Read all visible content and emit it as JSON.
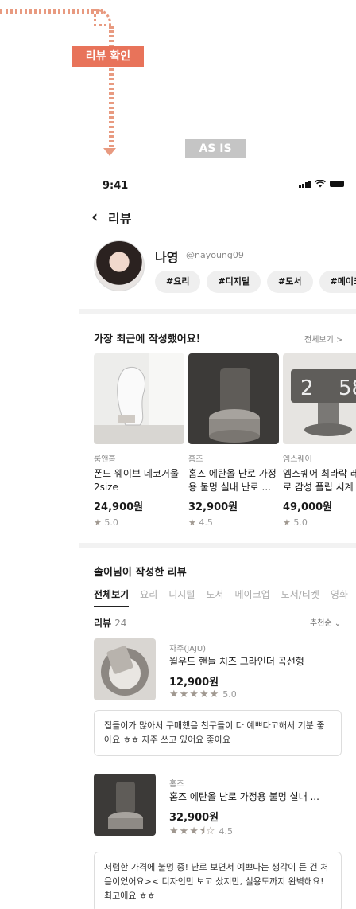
{
  "annotation": {
    "review_tag": "리뷰 확인",
    "asis_tag": "AS IS"
  },
  "status_bar": {
    "time": "9:41"
  },
  "header": {
    "title": "리뷰"
  },
  "profile": {
    "name": "나영",
    "handle": "@nayoung09",
    "tags": [
      "#요리",
      "#디지털",
      "#도서",
      "#메이크업"
    ]
  },
  "recent": {
    "title": "가장 최근에 작성했어요!",
    "see_all": "전체보기 >",
    "items": [
      {
        "brand": "룸앤홈",
        "name": "폰드 웨이브 데코거울 2size",
        "price": "24,900원",
        "rating": "5.0"
      },
      {
        "brand": "홈즈",
        "name": "홈즈 에탄올 난로 가정용 불멍 실내 난로 ...",
        "price": "32,900원",
        "rating": "4.5"
      },
      {
        "brand": "엠스퀘어",
        "name": "엠스퀘어 최라락 레트로 감성 플립 시계",
        "price": "49,000원",
        "rating": "5.0"
      }
    ]
  },
  "reviews": {
    "title": "솔이님이 작성한 리뷰",
    "tabs": [
      "전체보기",
      "요리",
      "디지털",
      "도서",
      "메이크업",
      "도서/티켓",
      "영화"
    ],
    "count_label": "리뷰",
    "count": "24",
    "sort": "추천순 ⌄",
    "items": [
      {
        "brand": "자주(JAJU)",
        "name": "월우드 핸들 치즈 그라인더 곡선형",
        "price": "12,900원",
        "stars": "★★★★★",
        "rating": "5.0",
        "text": "집들이가 많아서 구매했음 친구들이 다 예쁘다고해서 기분 좋아요 ㅎㅎ 자주 쓰고 있어요 좋아요"
      },
      {
        "brand": "홈즈",
        "name": "홈즈 에탄올 난로 가정용 불멍 실내 ...",
        "price": "32,900원",
        "stars": "★★★⯨☆",
        "rating": "4.5",
        "text": "저렴한 가격에 불멍 중! 난로 보면서 예쁘다는 생각이 든 건 처음이었어요>< 디자인만 보고 샀지만, 실용도까지 완벽해요! 최고에요 ㅎㅎ"
      }
    ]
  }
}
